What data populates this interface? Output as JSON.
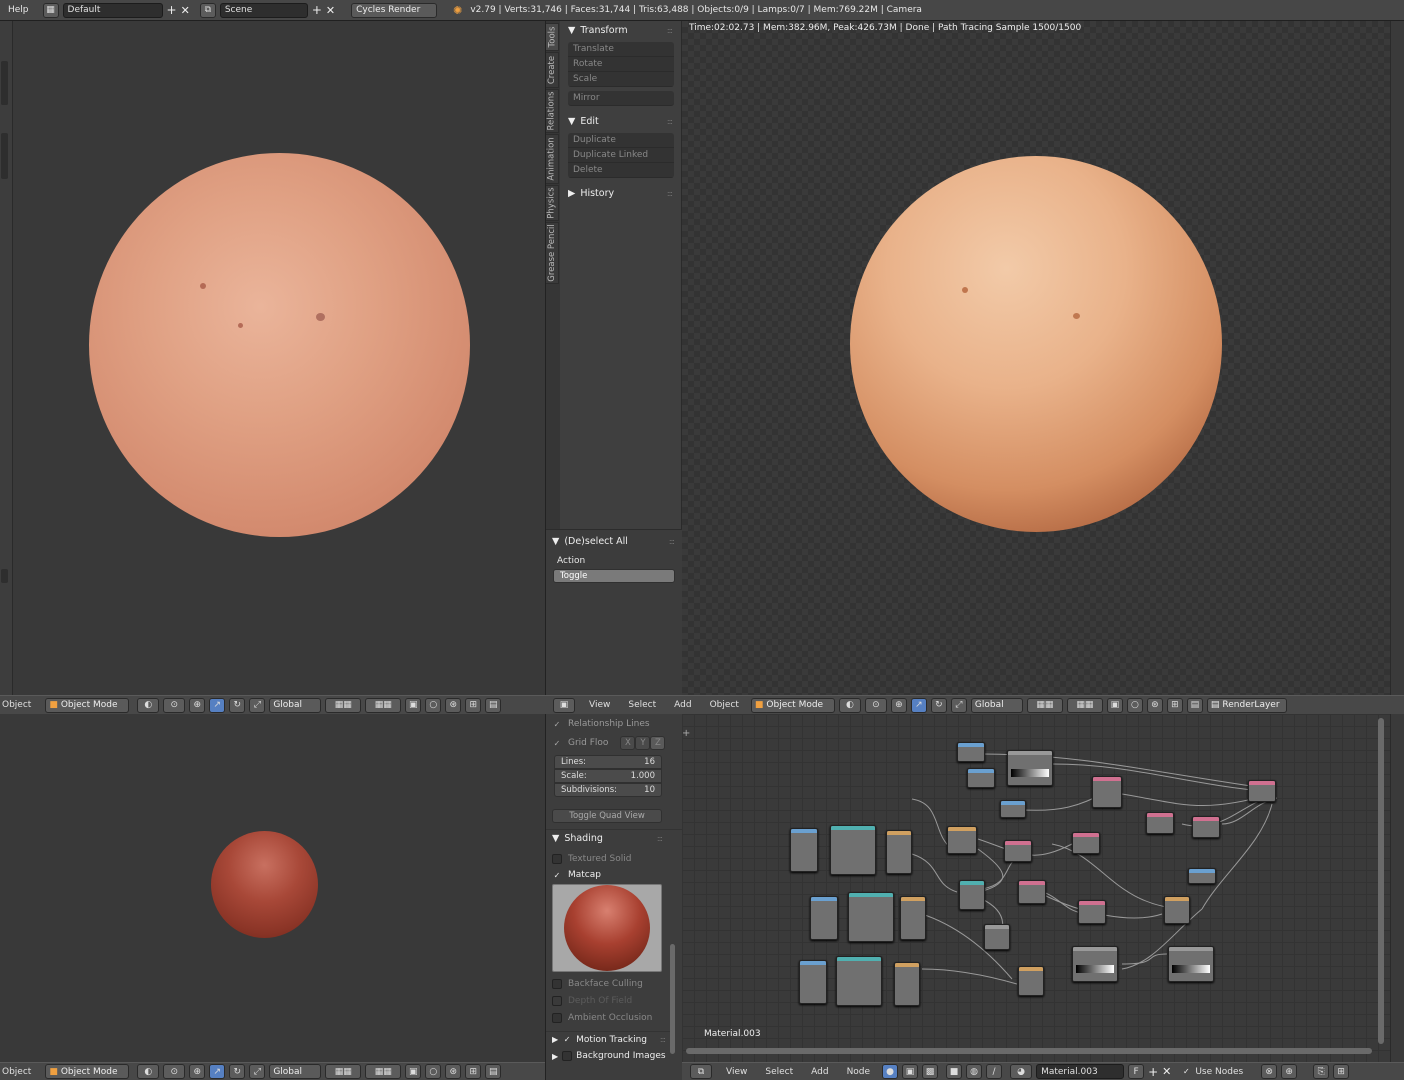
{
  "topbar": {
    "help": "Help",
    "layout": "Default",
    "scene": "Scene",
    "engine": "Cycles Render",
    "stats": "v2.79 | Verts:31,746 | Faces:31,744 | Tris:63,488 | Objects:0/9 | Lamps:0/7 | Mem:769.22M | Camera"
  },
  "tool_tabs": [
    "Tools",
    "Create",
    "Relations",
    "Animation",
    "Physics",
    "Grease Pencil"
  ],
  "tool_shelf": {
    "transform": {
      "title": "Transform",
      "items": [
        "Translate",
        "Rotate",
        "Scale"
      ],
      "mirror": "Mirror"
    },
    "edit": {
      "title": "Edit",
      "items": [
        "Duplicate",
        "Duplicate Linked",
        "Delete"
      ]
    },
    "history": {
      "title": "History"
    },
    "operator": {
      "title": "(De)select All",
      "action_label": "Action",
      "action_value": "Toggle"
    }
  },
  "render_view": {
    "status": "Time:02:02.73 | Mem:382.96M, Peak:426.73M | Done | Path Tracing Sample 1500/1500"
  },
  "header_top_left": {
    "menu": "Object",
    "mode": "Object Mode",
    "orientation": "Global"
  },
  "header_render": {
    "menus": [
      "View",
      "Select",
      "Add",
      "Object"
    ],
    "mode": "Object Mode",
    "orientation": "Global",
    "render_layer": "RenderLayer"
  },
  "header_bottom_left": {
    "menu": "Object",
    "mode": "Object Mode",
    "orientation": "Global"
  },
  "properties": {
    "relationship_lines": "Relationship Lines",
    "grid_floor": "Grid Floo",
    "axes": [
      "X",
      "Y",
      "Z"
    ],
    "lines_label": "Lines:",
    "lines_value": "16",
    "scale_label": "Scale:",
    "scale_value": "1.000",
    "subdiv_label": "Subdivisions:",
    "subdiv_value": "10",
    "toggle_quad": "Toggle Quad View",
    "shading_title": "Shading",
    "textured_solid": "Textured Solid",
    "matcap": "Matcap",
    "backface": "Backface Culling",
    "dof": "Depth Of Field",
    "ao": "Ambient Occlusion",
    "motion_tracking": "Motion Tracking",
    "background_images": "Background Images"
  },
  "node_editor": {
    "material_label": "Material.003",
    "menus": [
      "View",
      "Select",
      "Add",
      "Node"
    ],
    "material": "Material.003",
    "fake_user": "F",
    "use_nodes": "Use Nodes"
  },
  "colors": {
    "accent": "#5680c2",
    "skin": "#d99272",
    "matcap": "#9a3a2a"
  }
}
